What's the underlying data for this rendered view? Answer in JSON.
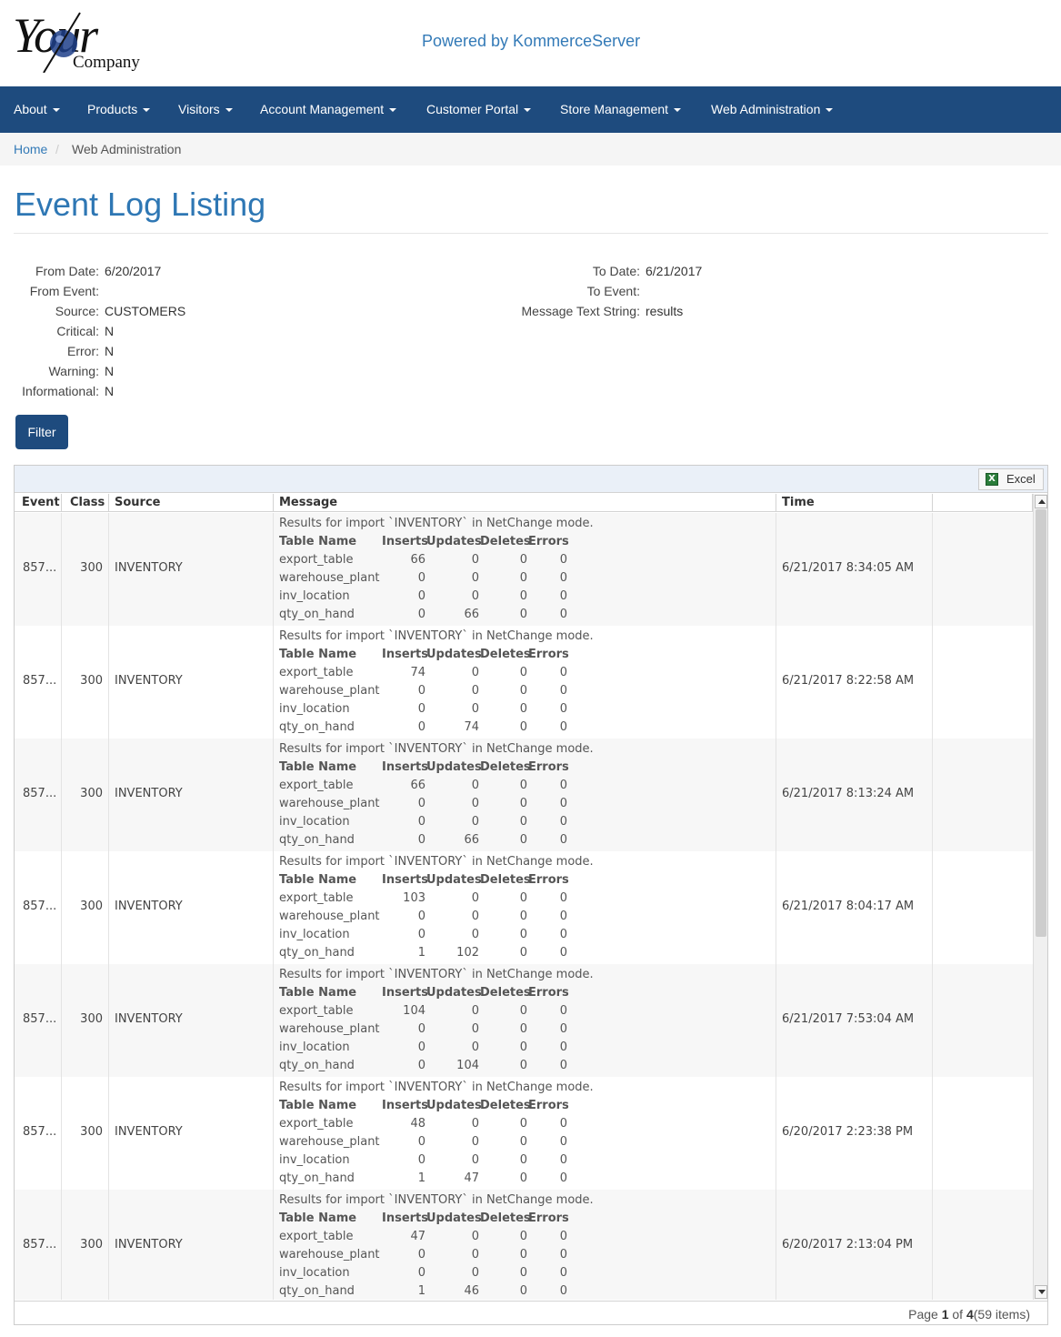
{
  "header": {
    "logo_your": "Your",
    "logo_company": "Company",
    "powered_by": "Powered by KommerceServer"
  },
  "nav": [
    {
      "label": "About"
    },
    {
      "label": "Products"
    },
    {
      "label": "Visitors"
    },
    {
      "label": "Account Management"
    },
    {
      "label": "Customer Portal"
    },
    {
      "label": "Store Management"
    },
    {
      "label": "Web Administration"
    }
  ],
  "breadcrumb": {
    "home": "Home",
    "separator": "/",
    "current": "Web Administration"
  },
  "page": {
    "title": "Event Log Listing"
  },
  "filters": {
    "from_date_label": "From Date:",
    "from_date": "6/20/2017",
    "to_date_label": "To Date:",
    "to_date": "6/21/2017",
    "from_event_label": "From Event:",
    "from_event": "",
    "to_event_label": "To Event:",
    "to_event": "",
    "source_label": "Source:",
    "source": "CUSTOMERS",
    "message_label": "Message Text String:",
    "message": "results",
    "critical_label": "Critical:",
    "critical": "N",
    "error_label": "Error:",
    "error": "N",
    "warning_label": "Warning:",
    "warning": "N",
    "informational_label": "Informational:",
    "informational": "N",
    "filter_button": "Filter"
  },
  "grid": {
    "excel_label": "Excel",
    "columns": {
      "event": "Event",
      "class": "Class",
      "source": "Source",
      "message": "Message",
      "time": "Time"
    },
    "message_headers": {
      "table": "Table Name",
      "inserts": "Inserts",
      "updates": "Updates",
      "deletes": "Deletes",
      "errors": "Errors"
    },
    "rows": [
      {
        "event": "857...",
        "class": "300",
        "source": "INVENTORY",
        "message_title": "Results for import `INVENTORY` in NetChange mode.",
        "time": "6/21/2017 8:34:05 AM",
        "tables": [
          {
            "name": "export_table",
            "inserts": "66",
            "updates": "0",
            "deletes": "0",
            "errors": "0"
          },
          {
            "name": "warehouse_plant",
            "inserts": "0",
            "updates": "0",
            "deletes": "0",
            "errors": "0"
          },
          {
            "name": "inv_location",
            "inserts": "0",
            "updates": "0",
            "deletes": "0",
            "errors": "0"
          },
          {
            "name": "qty_on_hand",
            "inserts": "0",
            "updates": "66",
            "deletes": "0",
            "errors": "0"
          }
        ]
      },
      {
        "event": "857...",
        "class": "300",
        "source": "INVENTORY",
        "message_title": "Results for import `INVENTORY` in NetChange mode.",
        "time": "6/21/2017 8:22:58 AM",
        "tables": [
          {
            "name": "export_table",
            "inserts": "74",
            "updates": "0",
            "deletes": "0",
            "errors": "0"
          },
          {
            "name": "warehouse_plant",
            "inserts": "0",
            "updates": "0",
            "deletes": "0",
            "errors": "0"
          },
          {
            "name": "inv_location",
            "inserts": "0",
            "updates": "0",
            "deletes": "0",
            "errors": "0"
          },
          {
            "name": "qty_on_hand",
            "inserts": "0",
            "updates": "74",
            "deletes": "0",
            "errors": "0"
          }
        ]
      },
      {
        "event": "857...",
        "class": "300",
        "source": "INVENTORY",
        "message_title": "Results for import `INVENTORY` in NetChange mode.",
        "time": "6/21/2017 8:13:24 AM",
        "tables": [
          {
            "name": "export_table",
            "inserts": "66",
            "updates": "0",
            "deletes": "0",
            "errors": "0"
          },
          {
            "name": "warehouse_plant",
            "inserts": "0",
            "updates": "0",
            "deletes": "0",
            "errors": "0"
          },
          {
            "name": "inv_location",
            "inserts": "0",
            "updates": "0",
            "deletes": "0",
            "errors": "0"
          },
          {
            "name": "qty_on_hand",
            "inserts": "0",
            "updates": "66",
            "deletes": "0",
            "errors": "0"
          }
        ]
      },
      {
        "event": "857...",
        "class": "300",
        "source": "INVENTORY",
        "message_title": "Results for import `INVENTORY` in NetChange mode.",
        "time": "6/21/2017 8:04:17 AM",
        "tables": [
          {
            "name": "export_table",
            "inserts": "103",
            "updates": "0",
            "deletes": "0",
            "errors": "0"
          },
          {
            "name": "warehouse_plant",
            "inserts": "0",
            "updates": "0",
            "deletes": "0",
            "errors": "0"
          },
          {
            "name": "inv_location",
            "inserts": "0",
            "updates": "0",
            "deletes": "0",
            "errors": "0"
          },
          {
            "name": "qty_on_hand",
            "inserts": "1",
            "updates": "102",
            "deletes": "0",
            "errors": "0"
          }
        ]
      },
      {
        "event": "857...",
        "class": "300",
        "source": "INVENTORY",
        "message_title": "Results for import `INVENTORY` in NetChange mode.",
        "time": "6/21/2017 7:53:04 AM",
        "tables": [
          {
            "name": "export_table",
            "inserts": "104",
            "updates": "0",
            "deletes": "0",
            "errors": "0"
          },
          {
            "name": "warehouse_plant",
            "inserts": "0",
            "updates": "0",
            "deletes": "0",
            "errors": "0"
          },
          {
            "name": "inv_location",
            "inserts": "0",
            "updates": "0",
            "deletes": "0",
            "errors": "0"
          },
          {
            "name": "qty_on_hand",
            "inserts": "0",
            "updates": "104",
            "deletes": "0",
            "errors": "0"
          }
        ]
      },
      {
        "event": "857...",
        "class": "300",
        "source": "INVENTORY",
        "message_title": "Results for import `INVENTORY` in NetChange mode.",
        "time": "6/20/2017 2:23:38 PM",
        "tables": [
          {
            "name": "export_table",
            "inserts": "48",
            "updates": "0",
            "deletes": "0",
            "errors": "0"
          },
          {
            "name": "warehouse_plant",
            "inserts": "0",
            "updates": "0",
            "deletes": "0",
            "errors": "0"
          },
          {
            "name": "inv_location",
            "inserts": "0",
            "updates": "0",
            "deletes": "0",
            "errors": "0"
          },
          {
            "name": "qty_on_hand",
            "inserts": "1",
            "updates": "47",
            "deletes": "0",
            "errors": "0"
          }
        ]
      },
      {
        "event": "857...",
        "class": "300",
        "source": "INVENTORY",
        "message_title": "Results for import `INVENTORY` in NetChange mode.",
        "time": "6/20/2017 2:13:04 PM",
        "tables": [
          {
            "name": "export_table",
            "inserts": "47",
            "updates": "0",
            "deletes": "0",
            "errors": "0"
          },
          {
            "name": "warehouse_plant",
            "inserts": "0",
            "updates": "0",
            "deletes": "0",
            "errors": "0"
          },
          {
            "name": "inv_location",
            "inserts": "0",
            "updates": "0",
            "deletes": "0",
            "errors": "0"
          },
          {
            "name": "qty_on_hand",
            "inserts": "1",
            "updates": "46",
            "deletes": "0",
            "errors": "0"
          }
        ]
      }
    ],
    "pager": {
      "prefix": "Page",
      "current": "1",
      "of": "of",
      "total_pages": "4",
      "items": "(59 items)"
    }
  }
}
